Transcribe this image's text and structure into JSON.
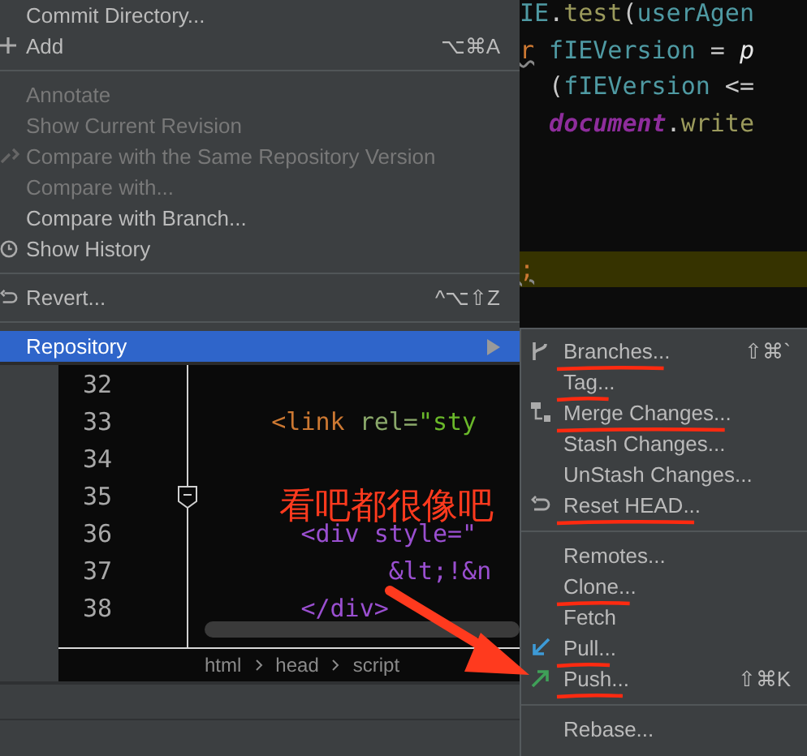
{
  "menu": {
    "items": [
      {
        "kind": "item",
        "label": "Commit Directory...",
        "disabled": false,
        "selected": false
      },
      {
        "kind": "item",
        "label": "Add",
        "shortcut": "⌥⌘A",
        "disabled": false,
        "selected": false
      },
      {
        "kind": "separator"
      },
      {
        "kind": "item",
        "label": "Annotate",
        "disabled": true,
        "selected": false
      },
      {
        "kind": "item",
        "label": "Show Current Revision",
        "disabled": true,
        "selected": false
      },
      {
        "kind": "item",
        "label": "Compare with the Same Repository Version",
        "disabled": true,
        "selected": false
      },
      {
        "kind": "item",
        "label": "Compare with...",
        "disabled": true,
        "selected": false
      },
      {
        "kind": "item",
        "label": "Compare with Branch...",
        "disabled": false,
        "selected": false
      },
      {
        "kind": "item",
        "label": "Show History",
        "disabled": false,
        "selected": false
      },
      {
        "kind": "separator"
      },
      {
        "kind": "item",
        "label": "Revert...",
        "shortcut": "^⌥⇧Z",
        "disabled": false,
        "selected": false
      },
      {
        "kind": "separator"
      },
      {
        "kind": "item",
        "label": "Repository",
        "disabled": false,
        "selected": true,
        "submenu": true
      }
    ]
  },
  "top_code": {
    "lines": [
      {
        "highlighted": false,
        "tokens": [
          {
            "kind": "ident",
            "text": "IE"
          },
          {
            "kind": "plain",
            "text": "."
          },
          {
            "kind": "func",
            "text": "test"
          },
          {
            "kind": "plain",
            "text": "("
          },
          {
            "kind": "ident",
            "text": "userAgen"
          }
        ]
      },
      {
        "highlighted": false,
        "tokens": [
          {
            "kind": "keyword",
            "text": "r"
          },
          {
            "kind": "ident",
            "text": "fIEVersion"
          },
          {
            "kind": "plain",
            "text": " = "
          },
          {
            "kind": "italic",
            "text": "p"
          }
        ]
      },
      {
        "highlighted": false,
        "tokens": [
          {
            "kind": "plain",
            "text": " ("
          },
          {
            "kind": "ident",
            "text": "fIEVersion"
          },
          {
            "kind": "plain",
            "text": " <="
          }
        ]
      },
      {
        "highlighted": false,
        "tokens": [
          {
            "kind": "global",
            "text": "document"
          },
          {
            "kind": "plain",
            "text": "."
          },
          {
            "kind": "func",
            "text": "write"
          }
        ]
      },
      {
        "highlighted": false
      },
      {
        "highlighted": false
      },
      {
        "highlighted": false
      },
      {
        "highlighted": true,
        "tokens": [
          {
            "kind": "keyword",
            "text": ";"
          }
        ]
      }
    ]
  },
  "editor": {
    "lines": [
      {
        "number": "32"
      },
      {
        "number": "33",
        "tokens": [
          {
            "kind": "tag",
            "text": "<link"
          },
          {
            "kind": "attr",
            "text": "rel="
          },
          {
            "kind": "string",
            "text": "\"sty"
          }
        ]
      },
      {
        "number": "34"
      },
      {
        "number": "35",
        "fold": true
      },
      {
        "number": "36",
        "tokens": [
          {
            "kind": "element",
            "text": "<div style=\""
          }
        ]
      },
      {
        "number": "37",
        "tokens": [
          {
            "kind": "element",
            "text": "&lt;!&n"
          }
        ]
      },
      {
        "number": "38",
        "tokens": [
          {
            "kind": "element",
            "text": "</div>"
          }
        ]
      }
    ],
    "breadcrumb": [
      "html",
      "head",
      "script"
    ]
  },
  "submenu": {
    "items": [
      {
        "kind": "item",
        "label": "Branches...",
        "shortcut": "⇧⌘`",
        "annotated": true
      },
      {
        "kind": "item",
        "label": "Tag...",
        "annotated": true
      },
      {
        "kind": "item",
        "label": "Merge Changes...",
        "annotated": true
      },
      {
        "kind": "item",
        "label": "Stash Changes...",
        "annotated": false
      },
      {
        "kind": "item",
        "label": "UnStash Changes...",
        "annotated": false
      },
      {
        "kind": "item",
        "label": "Reset HEAD...",
        "annotated": true
      },
      {
        "kind": "separator"
      },
      {
        "kind": "item",
        "label": "Remotes...",
        "annotated": false
      },
      {
        "kind": "item",
        "label": "Clone...",
        "annotated": true
      },
      {
        "kind": "item",
        "label": "Fetch",
        "annotated": false
      },
      {
        "kind": "item",
        "label": "Pull...",
        "annotated": true
      },
      {
        "kind": "item",
        "label": "Push...",
        "shortcut": "⇧⌘K",
        "annotated": true
      },
      {
        "kind": "separator"
      },
      {
        "kind": "item",
        "label": "Rebase...",
        "annotated": false
      }
    ]
  },
  "annotation": {
    "text": "看吧都很像吧"
  }
}
